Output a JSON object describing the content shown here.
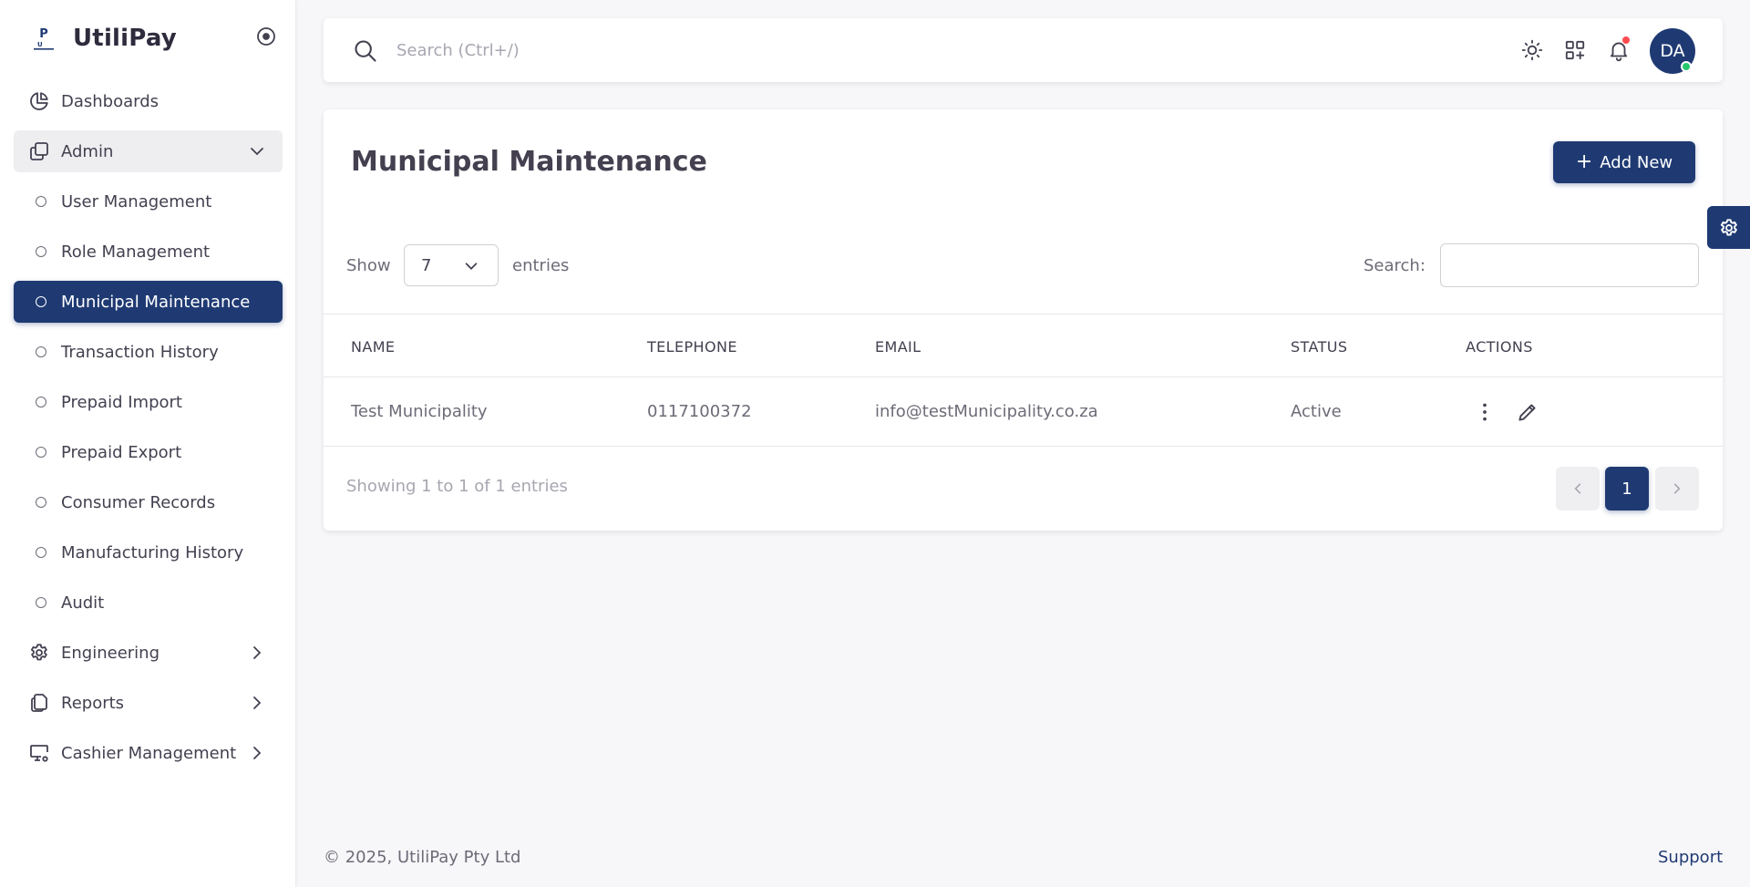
{
  "brand": {
    "name": "UtiliPay",
    "logo_text": "UP",
    "logo_sub": "UtiliPay"
  },
  "sidebar": {
    "items": [
      {
        "label": "Dashboards",
        "icon": "chart-pie-icon"
      },
      {
        "label": "Admin",
        "icon": "copy-icon",
        "open": true
      },
      {
        "label": "User Management"
      },
      {
        "label": "Role Management"
      },
      {
        "label": "Municipal Maintenance",
        "active": true
      },
      {
        "label": "Transaction History"
      },
      {
        "label": "Prepaid Import"
      },
      {
        "label": "Prepaid Export"
      },
      {
        "label": "Consumer Records"
      },
      {
        "label": "Manufacturing History"
      },
      {
        "label": "Audit"
      },
      {
        "label": "Engineering",
        "icon": "gear-icon"
      },
      {
        "label": "Reports",
        "icon": "files-icon"
      },
      {
        "label": "Cashier Management",
        "icon": "monitor-gear-icon"
      }
    ]
  },
  "topbar": {
    "search_placeholder": "Search (Ctrl+/)",
    "avatar_initials": "DA"
  },
  "page": {
    "title": "Municipal Maintenance",
    "add_button": "Add New",
    "show_label": "Show",
    "entries_value": "7",
    "entries_label": "entries",
    "search_label": "Search:"
  },
  "table": {
    "columns": [
      "NAME",
      "TELEPHONE",
      "EMAIL",
      "STATUS",
      "ACTIONS"
    ],
    "rows": [
      {
        "name": "Test Municipality",
        "telephone": "0117100372",
        "email": "info@testMunicipality.co.za",
        "status": "Active"
      }
    ]
  },
  "pagination": {
    "summary": "Showing 1 to 1 of 1 entries",
    "current_page": "1"
  },
  "footer": {
    "copyright": "© 2025, UtiliPay Pty Ltd",
    "support": "Support"
  },
  "colors": {
    "primary": "#1f3a73",
    "success": "#28c76f",
    "danger": "#ff4c51"
  }
}
